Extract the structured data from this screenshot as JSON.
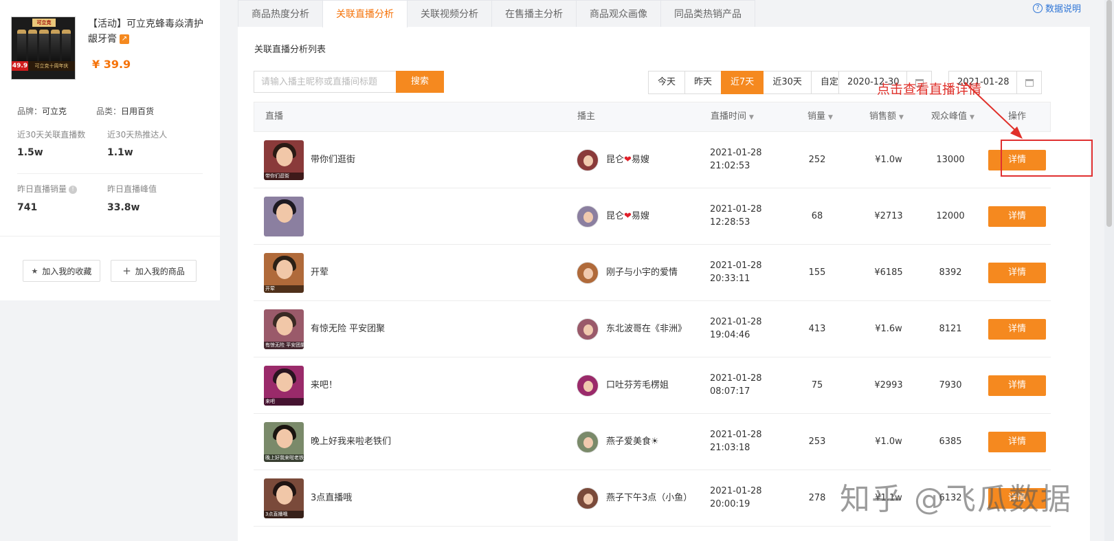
{
  "product": {
    "title": "【活动】可立克蜂毒焱清护龈牙膏",
    "price": "¥ 39.9",
    "image_badge": "49.9",
    "image_banner": "可立克十周年庆",
    "image_top": "可立克",
    "brand_label": "品牌：",
    "brand_value": "可立克",
    "category_label": "品类：",
    "category_value": "日用百货",
    "stats": [
      {
        "label": "近30天关联直播数",
        "value": "1.5w"
      },
      {
        "label": "近30天热推达人",
        "value": "1.1w"
      },
      {
        "label": "昨日直播销量",
        "value": "741"
      },
      {
        "label": "昨日直播峰值",
        "value": "33.8w"
      }
    ],
    "btn_collect": "加入我的收藏",
    "btn_add": "加入我的商品"
  },
  "tabs": [
    {
      "label": "商品热度分析"
    },
    {
      "label": "关联直播分析"
    },
    {
      "label": "关联视频分析"
    },
    {
      "label": "在售播主分析"
    },
    {
      "label": "商品观众画像"
    },
    {
      "label": "同品类热销产品"
    }
  ],
  "help_link": "数据说明",
  "panel_title": "关联直播分析列表",
  "search": {
    "placeholder": "请输入播主昵称或直播间标题",
    "button": "搜索"
  },
  "ranges": [
    "今天",
    "昨天",
    "近7天",
    "近30天",
    "自定义"
  ],
  "date_from": "2020-12-30",
  "date_to": "2021-01-28",
  "columns": [
    "直播",
    "播主",
    "直播时间",
    "销量",
    "销售额",
    "观众峰值",
    "操作"
  ],
  "rows": [
    {
      "title": "带你们逛街",
      "cap": "带你们逛街",
      "anchor_pre": "昆仑",
      "heart": "❤",
      "anchor_post": "易嫂",
      "date": "2021-01-28",
      "time": "21:02:53",
      "sales": "252",
      "amount": "¥1.0w",
      "peak": "13000",
      "action": "详情",
      "bg": "#8a3a3a",
      "hair": "#2a1a14"
    },
    {
      "title": "",
      "cap": "",
      "anchor_pre": "昆仑",
      "heart": "❤",
      "anchor_post": "易嫂",
      "date": "2021-01-28",
      "time": "12:28:53",
      "sales": "68",
      "amount": "¥2713",
      "peak": "12000",
      "action": "详情",
      "bg": "#8b7fa0",
      "hair": "#1e1a22"
    },
    {
      "title": "开荤",
      "cap": "开荤",
      "anchor_pre": "刚子与小宇的爱情",
      "heart": "",
      "anchor_post": "",
      "date": "2021-01-28",
      "time": "20:33:11",
      "sales": "155",
      "amount": "¥6185",
      "peak": "8392",
      "action": "详情",
      "bg": "#b06a3a",
      "hair": "#2b2016"
    },
    {
      "title": "有惊无险 平安团聚",
      "cap": "有惊无险 平安团聚",
      "anchor_pre": "东北波哥在《非洲》",
      "heart": "",
      "anchor_post": "",
      "date": "2021-01-28",
      "time": "19:04:46",
      "sales": "413",
      "amount": "¥1.6w",
      "peak": "8121",
      "action": "详情",
      "bg": "#9a5a6a",
      "hair": "#3a2a24"
    },
    {
      "title": "来吧！",
      "cap": "来吧",
      "anchor_pre": "口吐芬芳毛楞姐",
      "heart": "",
      "anchor_post": "",
      "date": "2021-01-28",
      "time": "08:07:17",
      "sales": "75",
      "amount": "¥2993",
      "peak": "7930",
      "action": "详情",
      "bg": "#9a2a6a",
      "hair": "#2a1420"
    },
    {
      "title": "晚上好我来啦老铁们",
      "cap": "晚上好我来啦老铁们",
      "anchor_pre": "燕子爱美食☀",
      "heart": "",
      "anchor_post": "",
      "date": "2021-01-28",
      "time": "21:03:18",
      "sales": "253",
      "amount": "¥1.0w",
      "peak": "6385",
      "action": "详情",
      "bg": "#7a8a6a",
      "hair": "#1a1410"
    },
    {
      "title": "3点直播哦",
      "cap": "3点直播哦",
      "anchor_pre": "燕子下午3点（小鱼）",
      "heart": "",
      "anchor_post": "",
      "date": "2021-01-28",
      "time": "20:00:19",
      "sales": "278",
      "amount": "¥1.1w",
      "peak": "6132",
      "action": "详情",
      "bg": "#7a4a3a",
      "hair": "#201412"
    }
  ],
  "annotation": "点击查看直播详情",
  "watermark": "知乎 @飞瓜数据"
}
